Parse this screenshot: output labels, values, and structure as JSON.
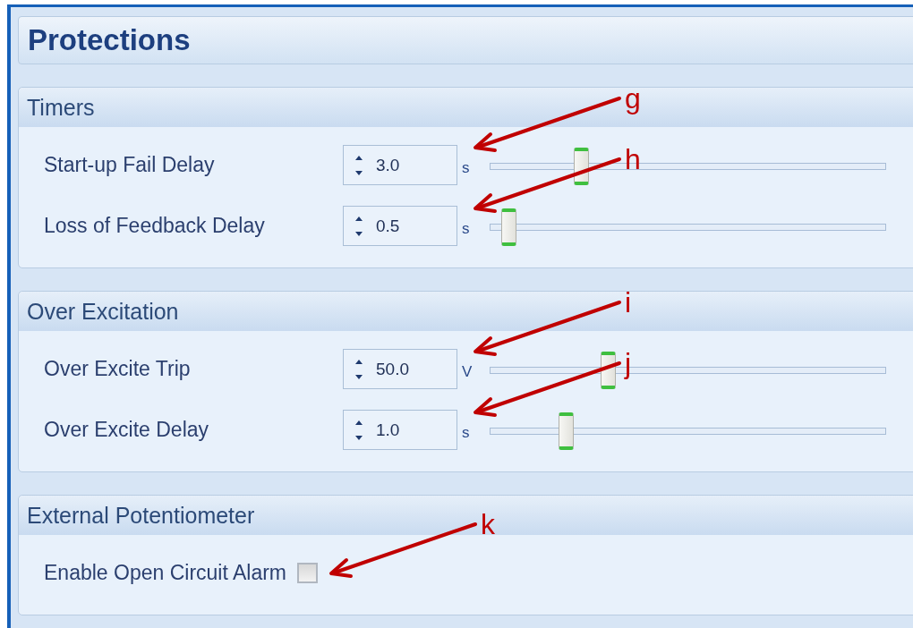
{
  "title": "Protections",
  "sections": [
    {
      "title": "Timers",
      "rows": [
        {
          "kind": "slider",
          "label": "Start-up Fail Delay",
          "value": "3.0",
          "unit": "s",
          "level": 0.22,
          "callout": "g"
        },
        {
          "kind": "slider",
          "label": "Loss of Feedback Delay",
          "value": "0.5",
          "unit": "s",
          "level": 0.03,
          "callout": "h"
        }
      ]
    },
    {
      "title": "Over Excitation",
      "rows": [
        {
          "kind": "slider",
          "label": "Over Excite Trip",
          "value": "50.0",
          "unit": "V",
          "level": 0.29,
          "callout": "i"
        },
        {
          "kind": "slider",
          "label": "Over Excite Delay",
          "value": "1.0",
          "unit": "s",
          "level": 0.18,
          "callout": "j"
        }
      ]
    },
    {
      "title": "External Potentiometer",
      "rows": [
        {
          "kind": "checkbox",
          "label": "Enable Open Circuit Alarm",
          "checked": false,
          "callout": "k"
        }
      ]
    }
  ]
}
